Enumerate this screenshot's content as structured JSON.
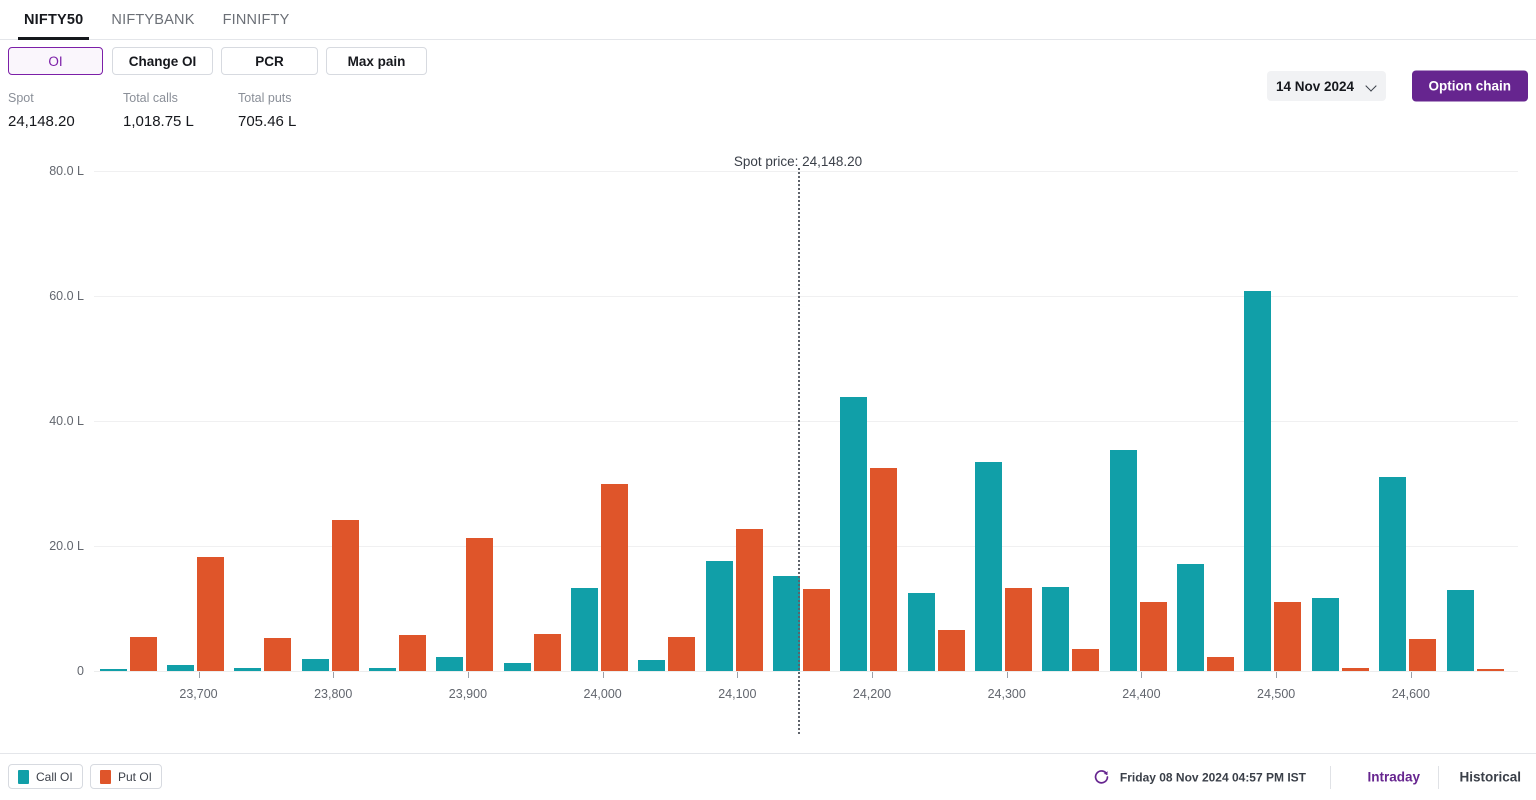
{
  "tabs": [
    {
      "label": "NIFTY50",
      "active": true
    },
    {
      "label": "NIFTYBANK",
      "active": false
    },
    {
      "label": "FINNIFTY",
      "active": false
    }
  ],
  "toolbar": {
    "oi_label": "OI",
    "change_oi_label": "Change OI",
    "pcr_label": "PCR",
    "max_pain_label": "Max pain",
    "expiry_value": "14 Nov 2024",
    "expiry_icon": "chevron-down-icon",
    "option_chain_label": "Option chain",
    "accent_color": "#66258f",
    "active_pill_color": "#7c1fa8"
  },
  "stats": {
    "spot_label": "Spot",
    "spot_value": "24,148.20",
    "total_calls_label": "Total calls",
    "total_calls_value": "1,018.75 L",
    "total_puts_label": "Total puts",
    "total_puts_value": "705.46 L"
  },
  "footer": {
    "legend_call_label": "Call OI",
    "legend_put_label": "Put OI",
    "call_color": "#119fa8",
    "put_color": "#df552a",
    "refresh_icon": "refresh-icon",
    "timestamp": "Friday 08 Nov 2024 04:57 PM IST",
    "intraday_label": "Intraday",
    "historical_label": "Historical"
  },
  "chart_data": {
    "type": "bar",
    "title": "",
    "xlabel": "",
    "ylabel": "",
    "ylim": [
      0,
      85
    ],
    "yticks": [
      0,
      20,
      40,
      60,
      80
    ],
    "ytick_labels": [
      "0",
      "20.0 L",
      "40.0 L",
      "60.0 L",
      "80.0 L"
    ],
    "grid": true,
    "legend_position": "bottom-left",
    "unit": "L",
    "annotation": {
      "label": "Spot price: 24,148.20",
      "value": 24148.2,
      "style": "dotted-vertical-line"
    },
    "xtick_labels": [
      "23,700",
      "23,800",
      "23,900",
      "24,000",
      "24,100",
      "24,200",
      "24,300",
      "24,400",
      "24,500",
      "24,600"
    ],
    "categories": [
      23650,
      23700,
      23750,
      23800,
      23850,
      23900,
      23950,
      24000,
      24050,
      24100,
      24150,
      24200,
      24250,
      24300,
      24350,
      24400,
      24450,
      24500,
      24550,
      24600,
      24650
    ],
    "series": [
      {
        "name": "Call OI",
        "color": "#119fa8",
        "values": [
          0.4,
          0.9,
          0.5,
          1.9,
          0.5,
          2.2,
          1.3,
          13.3,
          1.8,
          17.6,
          15.2,
          43.8,
          12.5,
          33.5,
          13.4,
          35.4,
          17.2,
          60.8,
          11.7,
          31.0,
          13.0
        ]
      },
      {
        "name": "Put OI",
        "color": "#df552a",
        "values": [
          5.4,
          18.2,
          5.3,
          24.1,
          5.8,
          21.3,
          5.9,
          30.0,
          5.5,
          22.8,
          13.2,
          32.5,
          6.6,
          13.3,
          3.6,
          11.0,
          2.2,
          11.0,
          0.5,
          5.1,
          0.3
        ]
      }
    ]
  }
}
